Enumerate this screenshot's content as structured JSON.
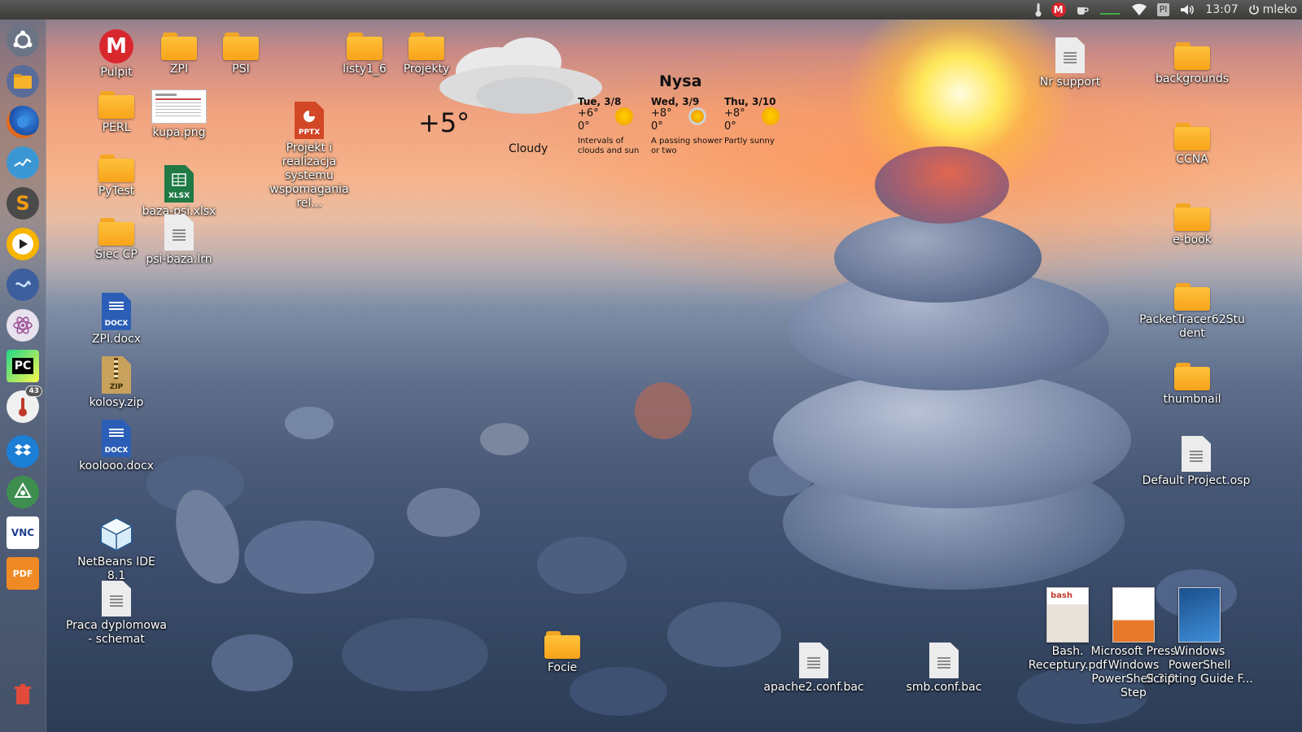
{
  "top_panel": {
    "clock": "13:07",
    "keyboard_layout": "Pl",
    "user": "mleko",
    "gmail_letter": "M"
  },
  "launcher": {
    "items": [
      {
        "name": "dash-home",
        "icon": "ubuntu-logo-icon"
      },
      {
        "name": "files",
        "icon": "folder-icon"
      },
      {
        "name": "firefox",
        "icon": "firefox-icon"
      },
      {
        "name": "system-monitor",
        "icon": "chart-icon"
      },
      {
        "name": "sublime-text",
        "icon": "sublime-icon",
        "letter": "S"
      },
      {
        "name": "media-player",
        "icon": "play-icon"
      },
      {
        "name": "remmina",
        "icon": "remote-icon"
      },
      {
        "name": "atom",
        "icon": "atom-icon"
      },
      {
        "name": "pycharm",
        "icon": "pycharm-icon",
        "letter": "PC"
      },
      {
        "name": "thermometer",
        "icon": "thermometer-icon",
        "badge": "43"
      },
      {
        "name": "dropbox",
        "icon": "dropbox-icon"
      },
      {
        "name": "inkscape",
        "icon": "inkscape-icon"
      },
      {
        "name": "vnc-viewer",
        "icon": "vnc-icon",
        "letter": "VNC"
      },
      {
        "name": "pdf-tool",
        "icon": "pdf-icon",
        "letter": "PDF"
      },
      {
        "name": "trash",
        "icon": "trash-icon"
      }
    ]
  },
  "desktop": {
    "icons": {
      "pulpit": "Pulpit",
      "zpi_folder": "ZPI",
      "psi": "PSI",
      "listy": "listy1_6",
      "projekty": "Projekty",
      "perl": "PERL",
      "kupa": "kupa.png",
      "pptx": "Projekt i realizacja systemu wspomagania rel...",
      "pytest": "PyTest",
      "baza_xlsx": "baza-psi.xlsx",
      "siec": "Siec CP",
      "psi_baza": "psi-baza.lrn",
      "zpi_docx": "ZPI.docx",
      "kolosy": "kolosy.zip",
      "koolooo": "koolooo.docx",
      "netbeans": "NetBeans IDE 8.1",
      "praca": "Praca dyplomowa - schemat",
      "focie": "Focie",
      "apache": "apache2.conf.bac",
      "smb": "smb.conf.bac",
      "nr_support": "Nr support",
      "backgrounds": "backgrounds",
      "ccna": "CCNA",
      "ebook": "e-book",
      "packettracer": "PacketTracer62Student",
      "thumbnail": "thumbnail",
      "default_project": "Default Project.osp",
      "bash_book": "Bash. Receptury.pdf",
      "ms_press": "Microsoft Press Windows PowerShell 3.0 Step",
      "ps_guide": "Windows PowerShell Scripting Guide F..."
    },
    "tags": {
      "pptx": "PPTX",
      "xlsx": "XLSX",
      "docx": "DOCX",
      "zip": "ZIP"
    }
  },
  "weather": {
    "temperature": "+5°",
    "condition": "Cloudy",
    "city": "Nysa",
    "forecast": [
      {
        "day": "Tue, 3/8",
        "high": "+6°",
        "low": "0°",
        "desc": "Intervals of clouds and sun"
      },
      {
        "day": "Wed, 3/9",
        "high": "+8°",
        "low": "0°",
        "desc": "A passing shower or two"
      },
      {
        "day": "Thu, 3/10",
        "high": "+8°",
        "low": "0°",
        "desc": "Partly sunny"
      }
    ]
  },
  "colors": {
    "folder": "#f7a41a",
    "gmail": "#d8232a",
    "panel": "#3c3b37"
  }
}
